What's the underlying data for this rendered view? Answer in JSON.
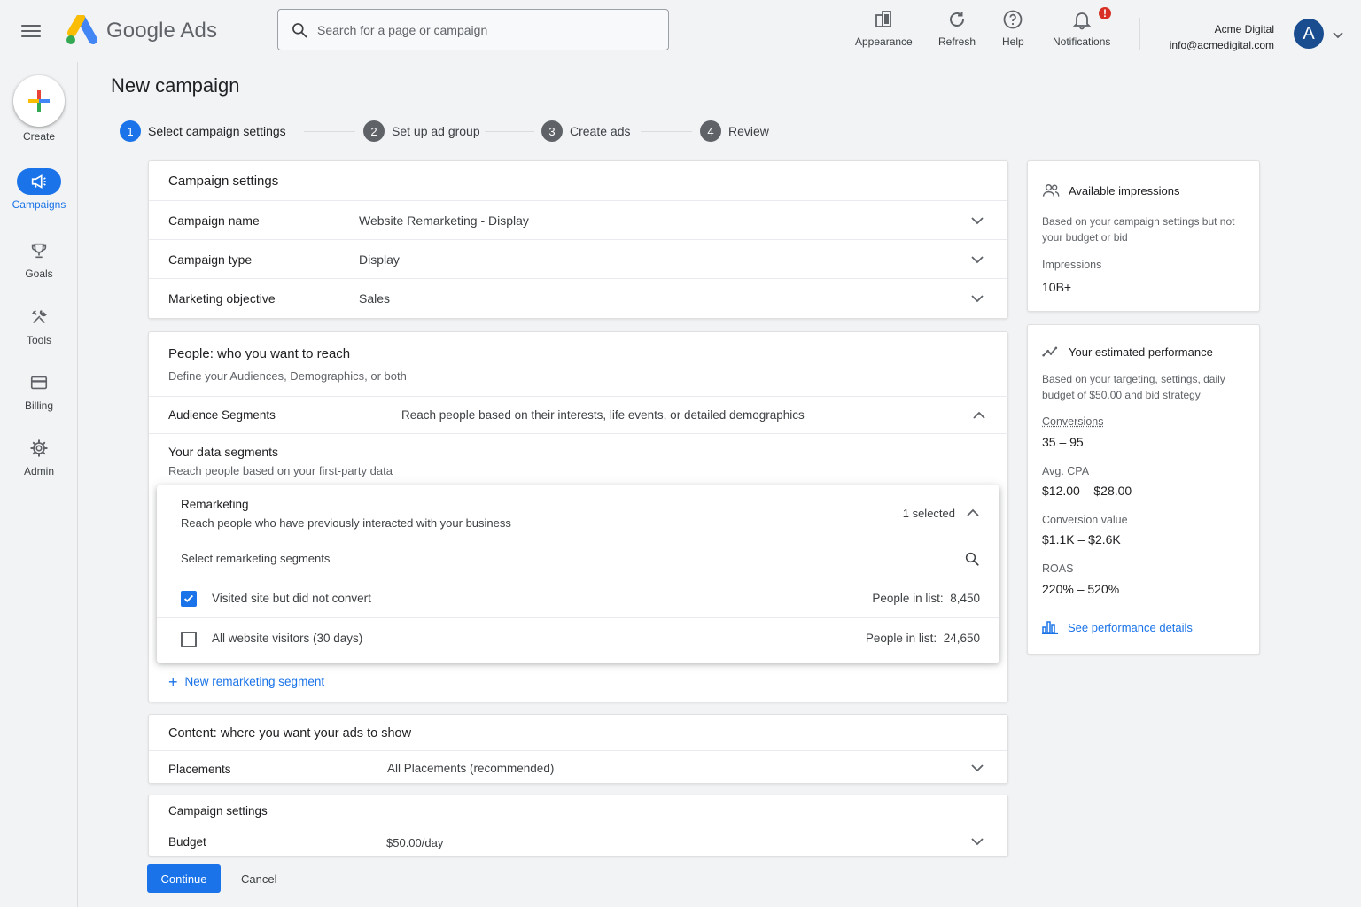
{
  "app": {
    "brand": "Google Ads"
  },
  "search": {
    "placeholder": "Search for a page or campaign"
  },
  "toolbar": {
    "appearance": "Appearance",
    "refresh": "Refresh",
    "help": "Help",
    "notifications": "Notifications",
    "notification_badge": "!"
  },
  "account": {
    "name": "Acme Digital",
    "email": "info@acmedigital.com",
    "avatar_letter": "A"
  },
  "nav": {
    "create": "Create",
    "campaigns": "Campaigns",
    "goals": "Goals",
    "tools": "Tools",
    "billing": "Billing",
    "admin": "Admin"
  },
  "page": {
    "title": "New campaign"
  },
  "steps": [
    {
      "num": "1",
      "label": "Select campaign settings"
    },
    {
      "num": "2",
      "label": "Set up ad group"
    },
    {
      "num": "3",
      "label": "Create ads"
    },
    {
      "num": "4",
      "label": "Review"
    }
  ],
  "campaign_settings": {
    "header": "Campaign settings",
    "rows": [
      {
        "label": "Campaign name",
        "value": "Website Remarketing - Display"
      },
      {
        "label": "Campaign type",
        "value": "Display"
      },
      {
        "label": "Marketing objective",
        "value": "Sales"
      }
    ]
  },
  "people": {
    "title": "People: who you want to reach",
    "subtitle": "Define your Audiences, Demographics, or both",
    "audience_label": "Audience Segments",
    "audience_value": "Reach people based on their interests, life events, or detailed demographics",
    "data_title": "Your data segments",
    "data_sub": "Reach people based on your first-party data",
    "new_segment": "New remarketing segment"
  },
  "remarketing": {
    "title": "Remarketing",
    "subtitle": "Reach people who have previously interacted with your business",
    "selected": "1 selected",
    "search_placeholder": "Select remarketing segments",
    "people_label": "People in list:",
    "items": [
      {
        "label": "Visited site but did not convert",
        "count": "8,450",
        "checked": true
      },
      {
        "label": "All website visitors (30 days)",
        "count": "24,650",
        "checked": false
      }
    ]
  },
  "content": {
    "title": "Content: where you want your ads to show",
    "placements_label": "Placements",
    "placements_value": "All Placements (recommended)"
  },
  "campaign_settings2": {
    "title": "Campaign settings",
    "budget_label": "Budget",
    "budget_value": "$50.00/day"
  },
  "actions": {
    "continue": "Continue",
    "cancel": "Cancel"
  },
  "impressions": {
    "title": "Available impressions",
    "sub": "Based on your campaign settings but not your budget or bid",
    "label": "Impressions",
    "value": "10B+"
  },
  "performance": {
    "title": "Your estimated performance",
    "sub": "Based on your targeting, settings, daily budget of $50.00 and bid strategy",
    "conversions_label": "Conversions",
    "conversions_value": "35 – 95",
    "cpa_label": "Avg. CPA",
    "cpa_value": "$12.00 – $28.00",
    "conv_value_label": "Conversion value",
    "conv_value_value": "$1.1K – $2.6K",
    "roas_label": "ROAS",
    "roas_value": "220% – 520%",
    "details_link": "See performance details"
  },
  "colors": {
    "accent": "#1a73e8",
    "badge": "#d93025",
    "avatar": "#1a4d8f"
  }
}
